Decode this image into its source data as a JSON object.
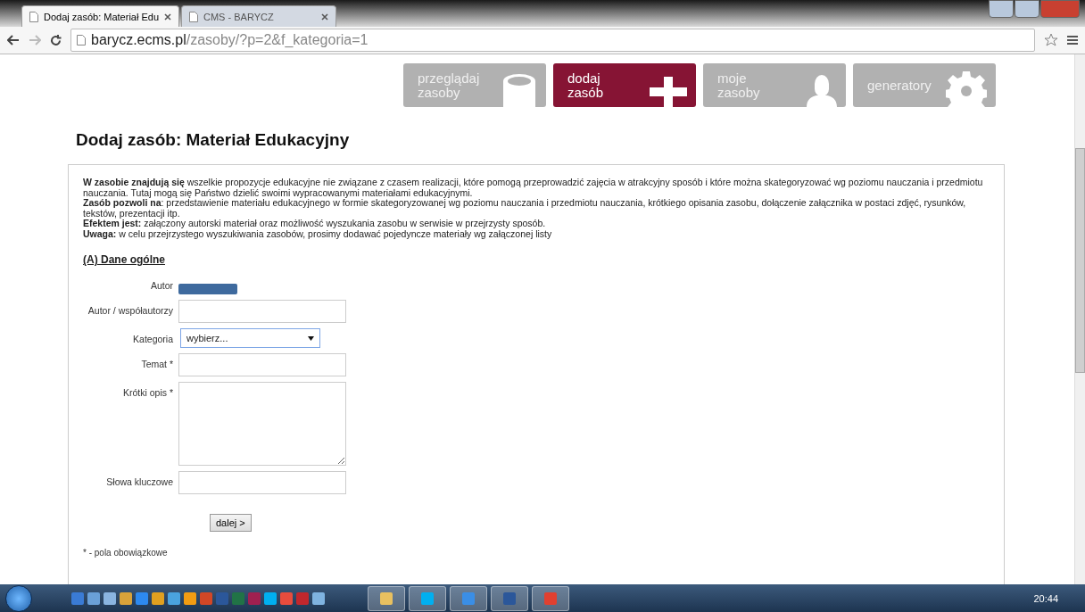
{
  "browser": {
    "tabs": [
      {
        "title": "Dodaj zasób: Materiał Edu",
        "selected": true
      },
      {
        "title": "CMS - BARYCZ",
        "selected": false
      }
    ],
    "url_host": "barycz.ecms.pl",
    "url_path": "/zasoby/?p=2&f_kategoria=1"
  },
  "nav": [
    {
      "kind": "db",
      "label": "przeglądaj\nzasoby",
      "selected": false
    },
    {
      "kind": "plus",
      "label": "dodaj\nzasób",
      "selected": true
    },
    {
      "kind": "user",
      "label": "moje\nzasoby",
      "selected": false
    },
    {
      "kind": "gear",
      "label": "generatory",
      "selected": false
    }
  ],
  "heading": "Dodaj zasób: Materiał Edukacyjny",
  "intro": [
    "**W zasobie znajdują się** wszelkie propozycje edukacyjne nie związane z czasem realizacji, które pomogą przeprowadzić zajęcia w atrakcyjny sposób i które można skategoryzować wg poziomu nauczania i przedmiotu nauczania. Tutaj mogą się Państwo dzielić swoimi wypracowanymi materiałami edukacyjnymi.",
    "**Zasób pozwoli na**: przedstawienie materiału edukacyjnego w formie skategoryzowanej wg poziomu nauczania i przedmiotu nauczania, krótkiego opisania zasobu, dołączenie załącznika w postaci zdjęć, rysunków, tekstów, prezentacji itp.",
    "**Efektem jest:** załączony autorski materiał oraz możliwość wyszukania zasobu w serwisie w przejrzysty sposób.",
    "**Uwaga:**  w celu przejrzystego wyszukiwania zasobów, prosimy dodawać pojedyncze materiały  wg załączonej listy"
  ],
  "section": "(A) Dane ogólne",
  "fields": [
    {
      "kind": "redacted",
      "label": "Autor"
    },
    {
      "kind": "text",
      "label": "Autor / współautorzy"
    },
    {
      "kind": "select",
      "label": "Kategoria",
      "value": "wybierz..."
    },
    {
      "kind": "text",
      "label": "Temat *"
    },
    {
      "kind": "textarea",
      "label": "Krótki opis *"
    },
    {
      "kind": "text",
      "label": "Słowa kluczowe"
    }
  ],
  "submit": "dalej >",
  "footnote": "* - pola obowiązkowe",
  "taskbar": {
    "clock": "20:44"
  }
}
